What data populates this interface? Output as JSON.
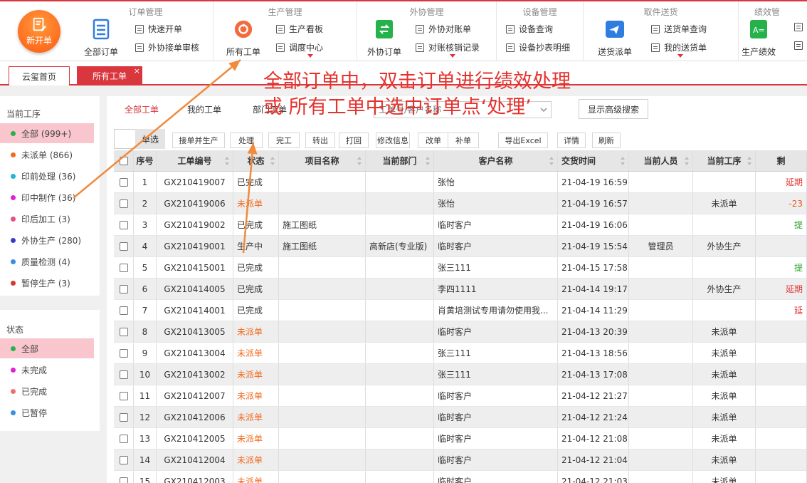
{
  "ribbon": {
    "new_order": "新开单",
    "groups": {
      "order": {
        "title": "订单管理",
        "big": "全部订单",
        "small": [
          "快速开单",
          "外协接单审核"
        ]
      },
      "production": {
        "title": "生产管理",
        "big": "所有工单",
        "small": [
          "生产看板",
          "调度中心"
        ]
      },
      "outsource": {
        "title": "外协管理",
        "big": "外协订单",
        "small": [
          "外协对账单",
          "对账核销记录"
        ]
      },
      "equipment": {
        "title": "设备管理",
        "small": [
          "设备查询",
          "设备抄表明细"
        ]
      },
      "delivery": {
        "title": "取件送货",
        "big": "送货派单",
        "small": [
          "送货单查询",
          "我的送货单"
        ]
      },
      "performance": {
        "title": "绩效管",
        "big": "生产绩效"
      }
    }
  },
  "tabs": {
    "home": "云玺首页",
    "active": "所有工单",
    "close": "×"
  },
  "stage_panel": {
    "title": "当前工序",
    "items": [
      {
        "label": "全部 (999+)",
        "color": "#25b24a"
      },
      {
        "label": "未派单 (866)",
        "color": "#f26b1d"
      },
      {
        "label": "印前处理 (36)",
        "color": "#1fb6d8"
      },
      {
        "label": "印中制作 (36)",
        "color": "#e020d8"
      },
      {
        "label": "印后加工 (3)",
        "color": "#e8507a"
      },
      {
        "label": "外协生产 (280)",
        "color": "#3a3acf"
      },
      {
        "label": "质量检测 (4)",
        "color": "#3a8ee0"
      },
      {
        "label": "暂停生产 (3)",
        "color": "#d23a3a"
      }
    ]
  },
  "status_panel": {
    "title": "状态",
    "items": [
      {
        "label": "全部",
        "color": "#25b24a"
      },
      {
        "label": "未完成",
        "color": "#e020d8"
      },
      {
        "label": "已完成",
        "color": "#f07070"
      },
      {
        "label": "已暂停",
        "color": "#3a8ee0"
      }
    ]
  },
  "subtabs": [
    "全部工单",
    "我的工单",
    "部门工单"
  ],
  "search": {
    "placeholder": "工单号/客户名称"
  },
  "advanced_search": "显示高级搜索",
  "toolbar": {
    "select_tab": "单选",
    "buttons": [
      "接单并生产",
      "处理",
      "完工",
      "转出",
      "打回",
      "修改信息",
      "改单",
      "补单",
      "导出Excel",
      "详情",
      "刷新"
    ]
  },
  "table": {
    "headers": [
      "序号",
      "工单编号",
      "状态",
      "项目名称",
      "当前部门",
      "客户名称",
      "交货时间",
      "当前人员",
      "当前工序",
      "剩"
    ],
    "rows": [
      [
        "1",
        "GX210419007",
        "已完成",
        "",
        "",
        "张怡",
        "21-04-19 16:59",
        "",
        "",
        "延期"
      ],
      [
        "2",
        "GX210419006",
        "未派单",
        "",
        "",
        "张怡",
        "21-04-19 16:57",
        "",
        "未派单",
        "-23"
      ],
      [
        "3",
        "GX210419002",
        "已完成",
        "施工图纸",
        "",
        "临时客户",
        "21-04-19 16:06",
        "",
        "",
        "提"
      ],
      [
        "4",
        "GX210419001",
        "生产中",
        "施工图纸",
        "高新店(专业版)",
        "临时客户",
        "21-04-19 15:54",
        "管理员",
        "外协生产",
        ""
      ],
      [
        "5",
        "GX210415001",
        "已完成",
        "",
        "",
        "张三111",
        "21-04-15 17:58",
        "",
        "",
        "提"
      ],
      [
        "6",
        "GX210414005",
        "已完成",
        "",
        "",
        "李四1111",
        "21-04-14 19:17",
        "",
        "外协生产",
        "延期"
      ],
      [
        "7",
        "GX210414001",
        "已完成",
        "",
        "",
        "肖黄培测试专用请勿使用我...",
        "21-04-14 11:29",
        "",
        "",
        "延"
      ],
      [
        "8",
        "GX210413005",
        "未派单",
        "",
        "",
        "临时客户",
        "21-04-13 20:39",
        "",
        "未派单",
        ""
      ],
      [
        "9",
        "GX210413004",
        "未派单",
        "",
        "",
        "张三111",
        "21-04-13 18:56",
        "",
        "未派单",
        ""
      ],
      [
        "10",
        "GX210413002",
        "未派单",
        "",
        "",
        "张三111",
        "21-04-13 17:08",
        "",
        "未派单",
        ""
      ],
      [
        "11",
        "GX210412007",
        "未派单",
        "",
        "",
        "临时客户",
        "21-04-12 21:27",
        "",
        "未派单",
        ""
      ],
      [
        "12",
        "GX210412006",
        "未派单",
        "",
        "",
        "临时客户",
        "21-04-12 21:24",
        "",
        "未派单",
        ""
      ],
      [
        "13",
        "GX210412005",
        "未派单",
        "",
        "",
        "临时客户",
        "21-04-12 21:08",
        "",
        "未派单",
        ""
      ],
      [
        "14",
        "GX210412004",
        "未派单",
        "",
        "",
        "临时客户",
        "21-04-12 21:04",
        "",
        "未派单",
        ""
      ],
      [
        "15",
        "GX210412003",
        "未派单",
        "",
        "",
        "临时客户",
        "21-04-12 21:03",
        "",
        "未派单",
        ""
      ]
    ]
  },
  "annotation": {
    "line1": "全部订单中，双击订单进行绩效处理",
    "line2": "或 所有工单中选中订单点‘处理’",
    "color": "#e5322e",
    "arrow_color": "#f08a3c"
  },
  "colors": {
    "accent": "#d9363e",
    "pending": "#f26b1d"
  }
}
